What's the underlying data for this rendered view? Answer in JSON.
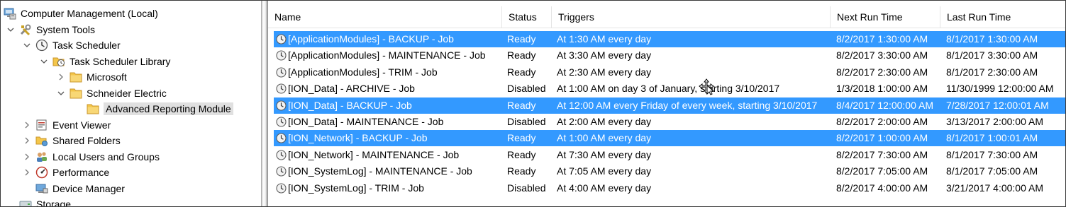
{
  "tree": {
    "items": [
      {
        "label": "Computer Management (Local)",
        "icon": "computer-management-icon",
        "toggle": "none",
        "indent": 0
      },
      {
        "label": "System Tools",
        "icon": "tools-icon",
        "toggle": "expanded",
        "indent": 1
      },
      {
        "label": "Task Scheduler",
        "icon": "clock-icon",
        "toggle": "expanded",
        "indent": 2
      },
      {
        "label": "Task Scheduler Library",
        "icon": "folder-clock-icon",
        "toggle": "expanded",
        "indent": 3
      },
      {
        "label": "Microsoft",
        "icon": "folder-icon",
        "toggle": "collapsed",
        "indent": 4
      },
      {
        "label": "Schneider Electric",
        "icon": "folder-icon",
        "toggle": "expanded",
        "indent": 4
      },
      {
        "label": "Advanced Reporting Module",
        "icon": "folder-icon",
        "toggle": "none",
        "indent": 5,
        "selected": true
      },
      {
        "label": "Event Viewer",
        "icon": "event-viewer-icon",
        "toggle": "collapsed",
        "indent": 2
      },
      {
        "label": "Shared Folders",
        "icon": "shared-folders-icon",
        "toggle": "collapsed",
        "indent": 2
      },
      {
        "label": "Local Users and Groups",
        "icon": "users-icon",
        "toggle": "collapsed",
        "indent": 2
      },
      {
        "label": "Performance",
        "icon": "performance-icon",
        "toggle": "collapsed",
        "indent": 2
      },
      {
        "label": "Device Manager",
        "icon": "device-manager-icon",
        "toggle": "none",
        "indent": 2
      },
      {
        "label": "Storage",
        "icon": "storage-icon",
        "toggle": "none",
        "indent": 1
      }
    ]
  },
  "table": {
    "columns": [
      "Name",
      "Status",
      "Triggers",
      "Next Run Time",
      "Last Run Time"
    ],
    "rows": [
      {
        "name": "[ApplicationModules] - BACKUP - Job",
        "status": "Ready",
        "triggers": "At 1:30 AM every day",
        "next": "8/2/2017 1:30:00 AM",
        "last": "8/1/2017 1:30:00 AM",
        "highlighted": true
      },
      {
        "name": "[ApplicationModules] - MAINTENANCE - Job",
        "status": "Ready",
        "triggers": "At 3:30 AM every day",
        "next": "8/2/2017 3:30:00 AM",
        "last": "8/1/2017 3:30:00 AM",
        "highlighted": false
      },
      {
        "name": "[ApplicationModules] - TRIM - Job",
        "status": "Ready",
        "triggers": "At 2:30 AM every day",
        "next": "8/2/2017 2:30:00 AM",
        "last": "8/1/2017 2:30:00 AM",
        "highlighted": false
      },
      {
        "name": "[ION_Data] - ARCHIVE - Job",
        "status": "Disabled",
        "triggers": "At 1:00 AM  on day 3 of January, starting 3/10/2017",
        "next": "1/3/2018 1:00:00 AM",
        "last": "11/30/1999 12:00:00 AM",
        "highlighted": false
      },
      {
        "name": "[ION_Data] - BACKUP - Job",
        "status": "Ready",
        "triggers": "At 12:00 AM every Friday of every week, starting 3/10/2017",
        "next": "8/4/2017 12:00:00 AM",
        "last": "7/28/2017 12:00:01 AM",
        "highlighted": true
      },
      {
        "name": "[ION_Data] - MAINTENANCE - Job",
        "status": "Disabled",
        "triggers": "At 2:00 AM every day",
        "next": "8/2/2017 2:00:00 AM",
        "last": "3/13/2017 2:00:00 AM",
        "highlighted": false
      },
      {
        "name": "[ION_Network] - BACKUP - Job",
        "status": "Ready",
        "triggers": "At 1:00 AM every day",
        "next": "8/2/2017 1:00:00 AM",
        "last": "8/1/2017 1:00:01 AM",
        "highlighted": true
      },
      {
        "name": "[ION_Network] - MAINTENANCE - Job",
        "status": "Ready",
        "triggers": "At 7:30 AM every day",
        "next": "8/2/2017 7:30:00 AM",
        "last": "8/1/2017 7:30:00 AM",
        "highlighted": false
      },
      {
        "name": "[ION_SystemLog] - MAINTENANCE - Job",
        "status": "Ready",
        "triggers": "At 7:05 AM every day",
        "next": "8/2/2017 7:05:00 AM",
        "last": "8/1/2017 7:05:00 AM",
        "highlighted": false
      },
      {
        "name": "[ION_SystemLog] - TRIM - Job",
        "status": "Disabled",
        "triggers": "At 4:00 AM every day",
        "next": "8/2/2017 4:00:00 AM",
        "last": "3/21/2017 4:00:00 AM",
        "highlighted": false
      }
    ]
  },
  "colors": {
    "selection": "#3399ff",
    "tree_selection": "#e0e0e0",
    "folder": "#f4c64a"
  }
}
